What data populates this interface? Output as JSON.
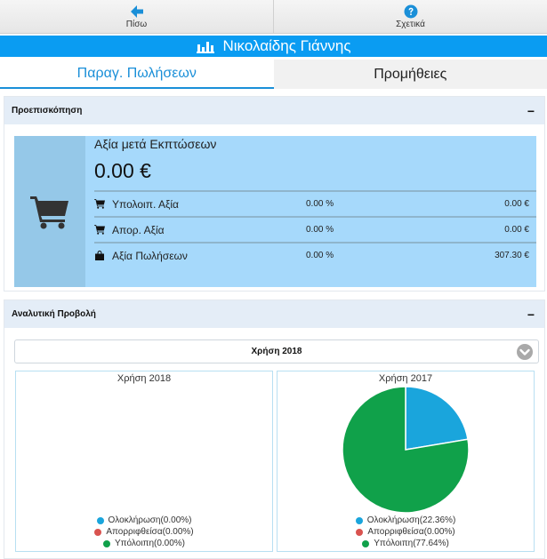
{
  "toolbar": {
    "back_label": "Πίσω",
    "about_label": "Σχετικά"
  },
  "header": {
    "title": "Νικολαίδης Γιάννης"
  },
  "tabs": [
    {
      "label": "Παραγ. Πωλήσεων",
      "active": true
    },
    {
      "label": "Προμήθειες",
      "active": false
    }
  ],
  "overview_panel": {
    "title": "Προεπισκόπηση",
    "collapse_symbol": "−",
    "main_label": "Αξία μετά Εκπτώσεων",
    "main_value": "0.00 €",
    "rows": [
      {
        "icon": "cart-icon",
        "label": "Υπολοιπ. Αξία",
        "percent": "0.00 %",
        "amount": "0.00 €"
      },
      {
        "icon": "cart-icon",
        "label": "Απορ. Αξία",
        "percent": "0.00 %",
        "amount": "0.00 €"
      },
      {
        "icon": "bag-icon",
        "label": "Αξία Πωλήσεων",
        "percent": "0.00 %",
        "amount": "307.30 €"
      }
    ]
  },
  "analysis_panel": {
    "title": "Αναλυτική Προβολή",
    "collapse_symbol": "−",
    "year_select": "Χρήση 2018",
    "charts": [
      {
        "title": "Χρήση 2018",
        "legend": [
          "Ολοκλήρωση(0.00%)",
          "Απορριφθείσα(0.00%)",
          "Υπόλοιπη(0.00%)"
        ]
      },
      {
        "title": "Χρήση 2017",
        "legend": [
          "Ολοκλήρωση(22.36%)",
          "Απορριφθείσα(0.00%)",
          "Υπόλοιπη(77.64%)"
        ]
      }
    ]
  },
  "chart_data": [
    {
      "type": "pie",
      "title": "Χρήση 2018",
      "categories": [
        "Ολοκλήρωση",
        "Απορριφθείσα",
        "Υπόλοιπη"
      ],
      "values": [
        0.0,
        0.0,
        0.0
      ]
    },
    {
      "type": "pie",
      "title": "Χρήση 2017",
      "categories": [
        "Ολοκλήρωση",
        "Απορριφθείσα",
        "Υπόλοιπη"
      ],
      "values": [
        22.36,
        0.0,
        77.64
      ]
    }
  ],
  "colors": {
    "accent": "#0a9cf2",
    "completed": "#1aa5dc",
    "rejected": "#d9534f",
    "remaining": "#10a14a"
  }
}
